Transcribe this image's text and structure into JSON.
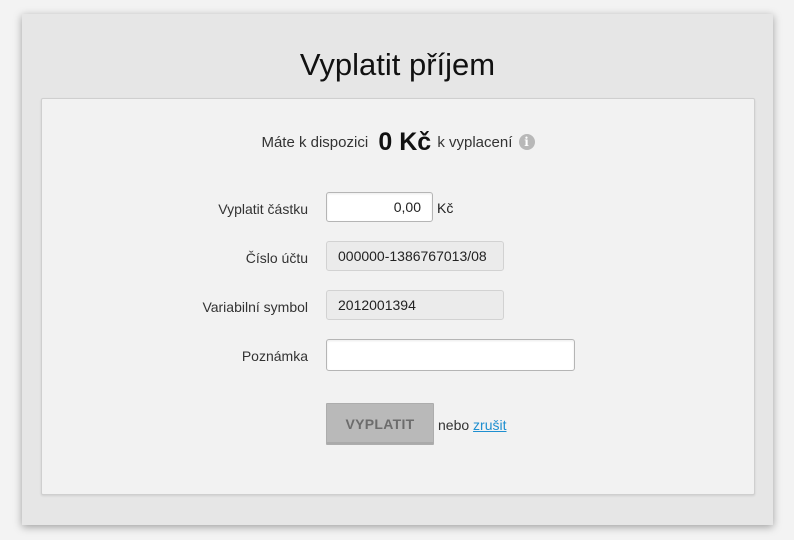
{
  "dialog": {
    "title": "Vyplatit příjem"
  },
  "balance": {
    "prefix": "Máte k dispozici",
    "amount": "0 Kč",
    "suffix": "k vyplacení",
    "info_icon": "info-icon"
  },
  "form": {
    "amount": {
      "label": "Vyplatit částku",
      "value": "0,00",
      "unit": "Kč"
    },
    "account": {
      "label": "Číslo účtu",
      "value": "000000-1386767013/08"
    },
    "variable_symbol": {
      "label": "Variabilní symbol",
      "value": "2012001394"
    },
    "note": {
      "label": "Poznámka",
      "value": ""
    }
  },
  "actions": {
    "submit_label": "VYPLATIT",
    "or_text": "nebo",
    "cancel_label": "zrušit"
  }
}
